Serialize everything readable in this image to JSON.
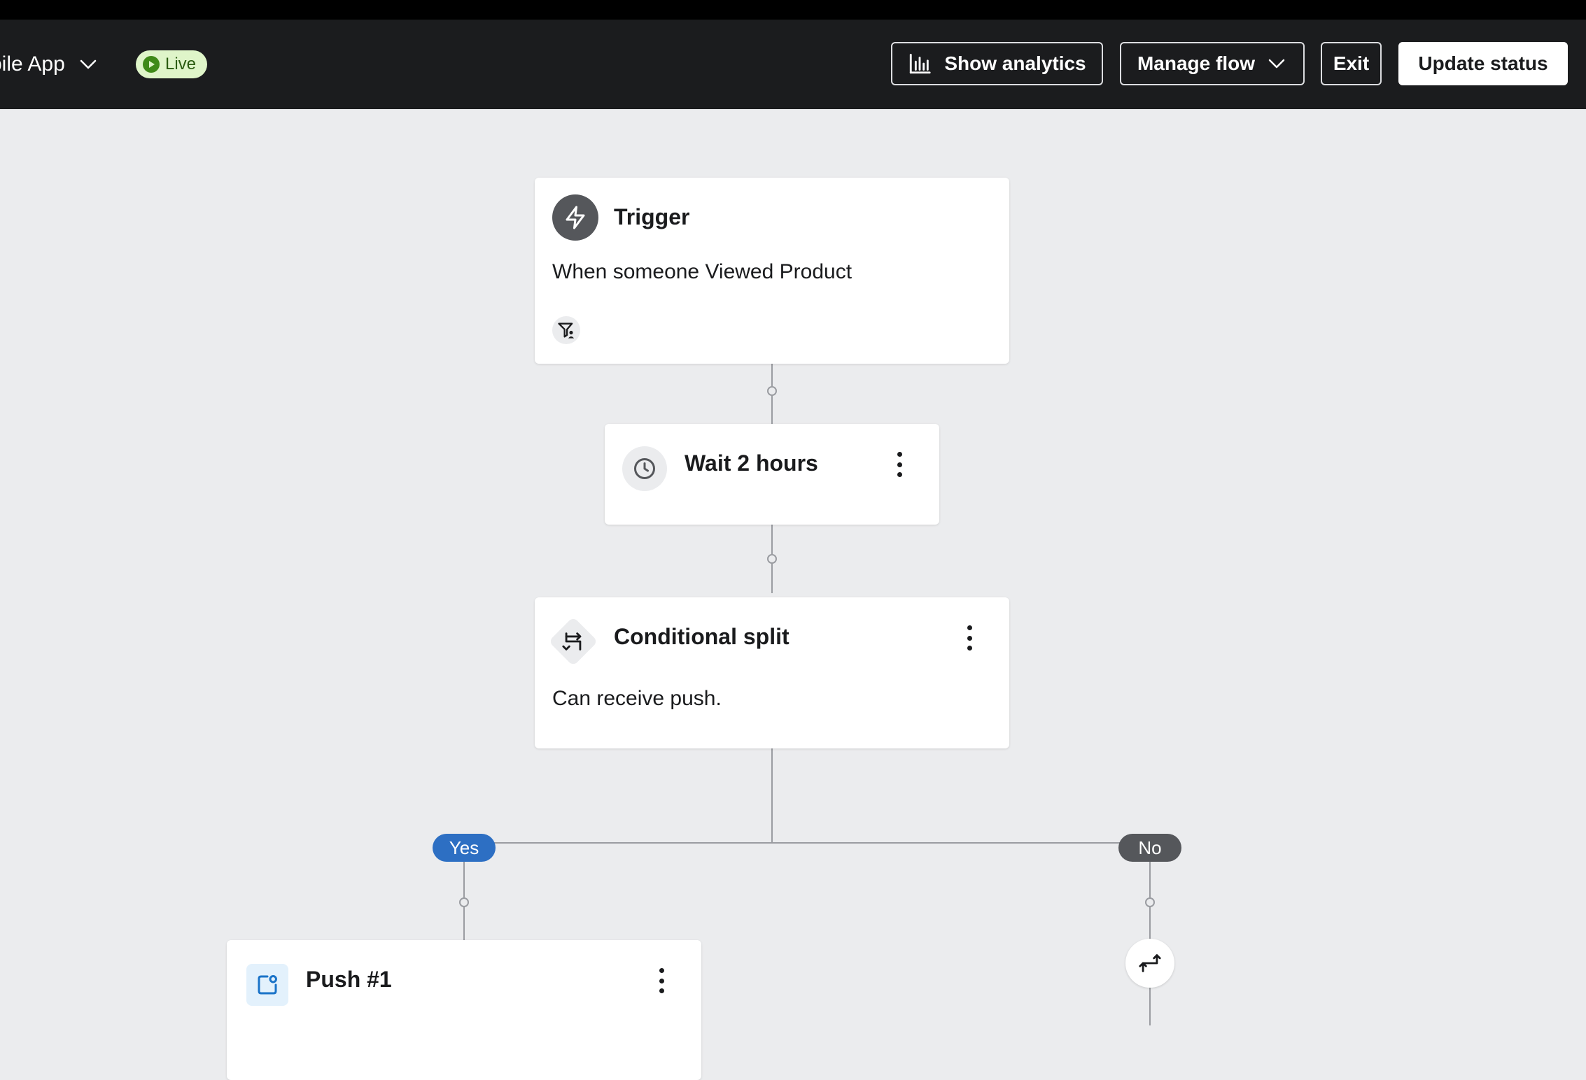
{
  "header": {
    "flow_name": "bile App",
    "status_badge": "Live",
    "buttons": {
      "show_analytics": "Show analytics",
      "manage_flow": "Manage flow",
      "exit": "Exit",
      "update_status": "Update status"
    }
  },
  "flow": {
    "trigger": {
      "title": "Trigger",
      "description": "When someone Viewed Product",
      "icon": "lightning-icon",
      "filter_icon": "profile-filter-icon"
    },
    "wait": {
      "title": "Wait 2 hours",
      "icon": "clock-icon"
    },
    "split": {
      "title": "Conditional split",
      "description": "Can receive push.",
      "icon": "split-icon"
    },
    "branches": {
      "yes": "Yes",
      "no": "No"
    },
    "push": {
      "title": "Push #1",
      "icon": "push-notification-icon"
    },
    "no_branch_action_icon": "exit-arrow-icon"
  },
  "colors": {
    "header_bg": "#1b1c1e",
    "canvas_bg": "#ebecee",
    "live_badge_bg": "#dff5c9",
    "live_badge_fg": "#2a5b10",
    "yes_label": "#2d6fc3",
    "no_label": "#55575b",
    "push_icon_bg": "#e3f1fc",
    "push_icon_fg": "#1a73c8"
  }
}
